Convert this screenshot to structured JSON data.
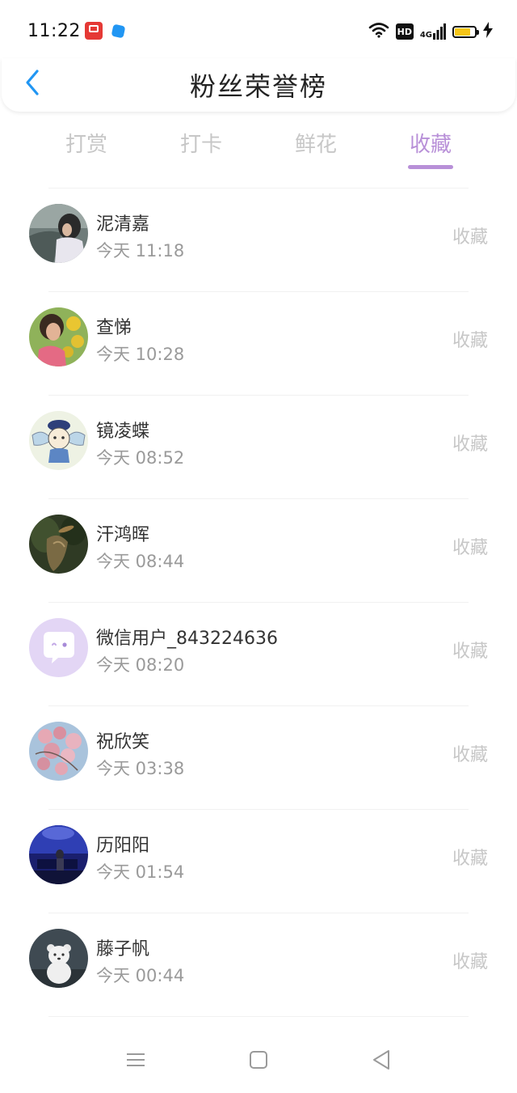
{
  "status_bar": {
    "time": "11:22",
    "network": "4G",
    "hd": "HD",
    "icons": [
      "app-icon-red",
      "app-icon-blue",
      "wifi-icon",
      "hd-icon",
      "signal-icon",
      "battery-icon",
      "charging-icon"
    ]
  },
  "header": {
    "title": "粉丝荣誉榜",
    "back_icon": "chevron-left-icon"
  },
  "tabs": [
    {
      "label": "打赏",
      "active": false
    },
    {
      "label": "打卡",
      "active": false
    },
    {
      "label": "鲜花",
      "active": false
    },
    {
      "label": "收藏",
      "active": true
    }
  ],
  "fans": [
    {
      "name": "泥清嘉",
      "time": "今天 11:18",
      "action": "收藏",
      "avatar": "photo-avatar"
    },
    {
      "name": "查悌",
      "time": "今天 10:28",
      "action": "收藏",
      "avatar": "photo-avatar"
    },
    {
      "name": "镜凌蝶",
      "time": "今天 08:52",
      "action": "收藏",
      "avatar": "cartoon-avatar"
    },
    {
      "name": "汗鸿晖",
      "time": "今天 08:44",
      "action": "收藏",
      "avatar": "photo-avatar"
    },
    {
      "name": "微信用户_843224636",
      "time": "今天 08:20",
      "action": "收藏",
      "avatar": "default-chat-avatar"
    },
    {
      "name": "祝欣笑",
      "time": "今天 03:38",
      "action": "收藏",
      "avatar": "flower-avatar"
    },
    {
      "name": "历阳阳",
      "time": "今天 01:54",
      "action": "收藏",
      "avatar": "photo-avatar"
    },
    {
      "name": "藤子帆",
      "time": "今天 00:44",
      "action": "收藏",
      "avatar": "cartoon-avatar"
    }
  ],
  "nav": {
    "icons": [
      "menu-icon",
      "home-icon",
      "back-icon"
    ]
  },
  "colors": {
    "accent": "#b890d8",
    "back_arrow": "#2196f3",
    "inactive_text": "#c7c7c7",
    "secondary_text": "#9a9a9a"
  }
}
